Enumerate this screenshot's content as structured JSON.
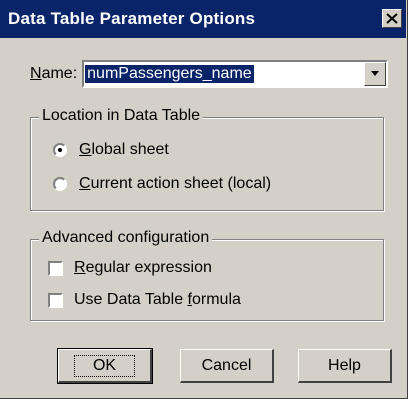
{
  "window": {
    "title": "Data Table Parameter Options",
    "close_glyph": "✕"
  },
  "name_field": {
    "label_prefix": "N",
    "label_rest": "ame:",
    "value": "numPassengers_name"
  },
  "location_group": {
    "legend": "Location in Data Table",
    "options": [
      {
        "underline": "G",
        "rest": "lobal sheet",
        "selected": true
      },
      {
        "underline": "C",
        "rest": "urrent action sheet (local)",
        "selected": false
      }
    ]
  },
  "advanced_group": {
    "legend": "Advanced configuration",
    "options": [
      {
        "underline": "R",
        "rest": "egular expression",
        "checked": false
      },
      {
        "prefix": "Use Data Table ",
        "underline": "f",
        "rest": "ormula",
        "checked": false
      }
    ]
  },
  "buttons": {
    "ok": "OK",
    "cancel": "Cancel",
    "help": "Help"
  }
}
